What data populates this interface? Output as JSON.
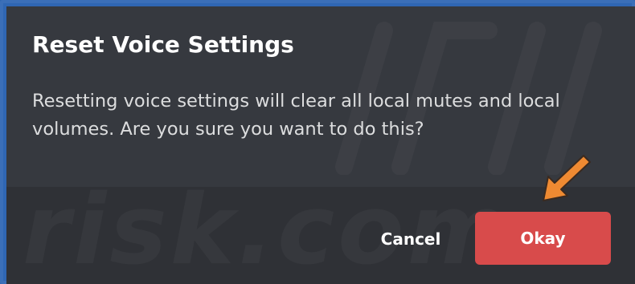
{
  "dialog": {
    "title": "Reset Voice Settings",
    "message": "Resetting voice settings will clear all local mutes and local volumes. Are you sure you want to do this?",
    "cancel_label": "Cancel",
    "confirm_label": "Okay"
  },
  "watermark": {
    "text": "risk.com"
  },
  "annotation": {
    "icon": "arrow-pointer-icon",
    "color": "#ef8a32"
  },
  "colors": {
    "dialog_bg": "#36393f",
    "footer_bg": "#2f3136",
    "danger": "#d84b4b",
    "frame": "#2f66b3"
  }
}
